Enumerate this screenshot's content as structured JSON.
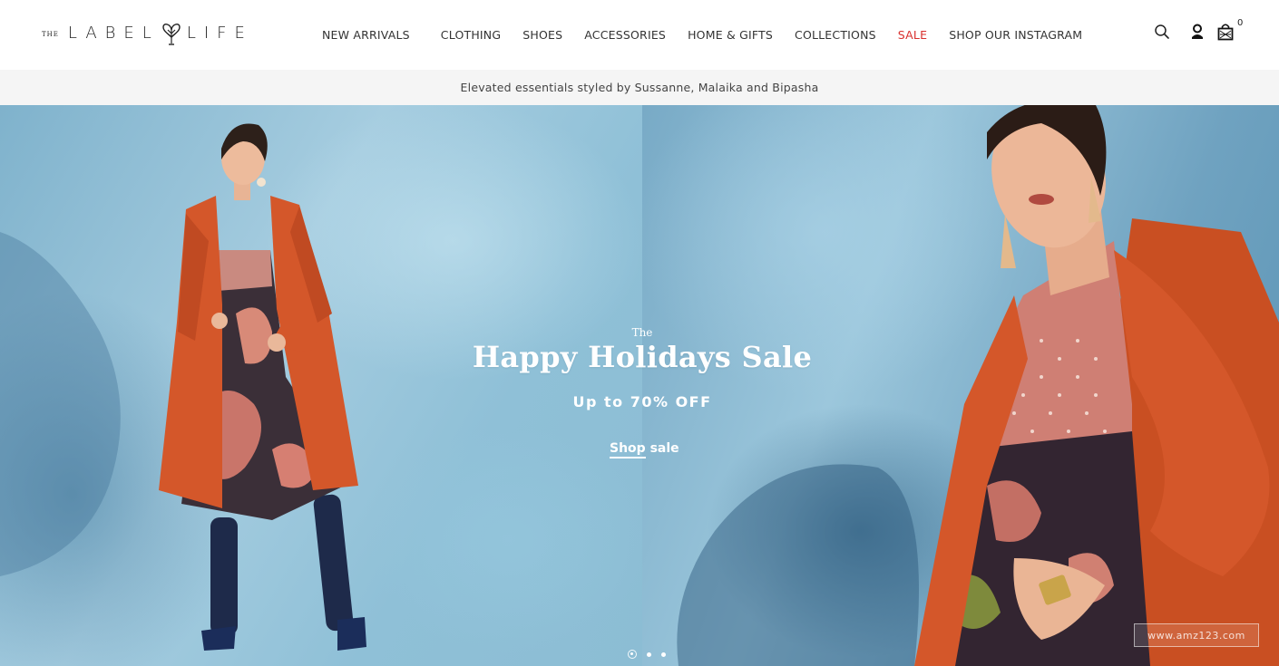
{
  "brand": {
    "logo_small": "THE",
    "logo_left": "LABEL",
    "logo_right": "LIFE"
  },
  "nav": {
    "items": [
      {
        "label": "NEW ARRIVALS"
      },
      {
        "label": "CLOTHING"
      },
      {
        "label": "SHOES"
      },
      {
        "label": "ACCESSORIES"
      },
      {
        "label": "HOME & GIFTS"
      },
      {
        "label": "COLLECTIONS"
      },
      {
        "label": "SALE",
        "color": "#d9302e"
      },
      {
        "label": "SHOP OUR INSTAGRAM"
      }
    ]
  },
  "header_icons": {
    "search": "search-icon",
    "account": "user-icon",
    "cart": "shopping-bag-icon",
    "cart_count": "0"
  },
  "announcement": {
    "text": "Elevated essentials styled by Sussanne, Malaika and Bipasha"
  },
  "hero": {
    "kicker": "The",
    "title": "Happy Holidays Sale",
    "subtitle": "Up to 70% OFF",
    "cta_underlined": "Shop",
    "cta_rest": " sale",
    "slides_total": 3,
    "active_slide": 1
  },
  "watermark": {
    "text": "www.amz123.com"
  },
  "colors": {
    "sale": "#d9302e",
    "coat": "#d4572a",
    "sky": "#8ebfd6"
  }
}
